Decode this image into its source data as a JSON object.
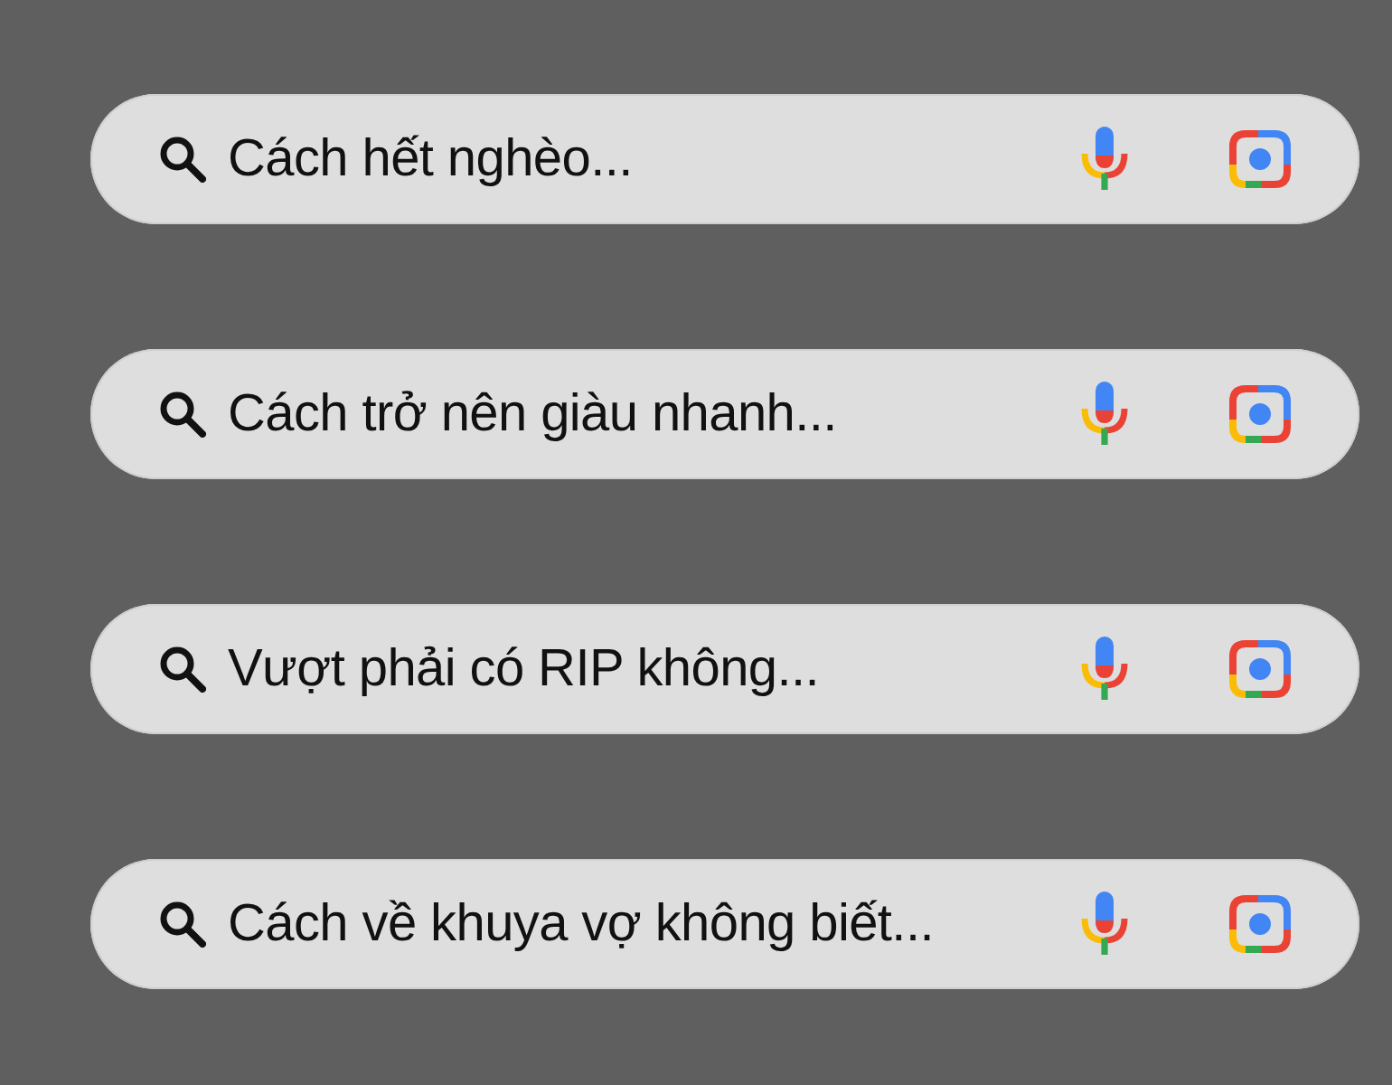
{
  "search_bars": [
    {
      "value": "Cách hết nghèo..."
    },
    {
      "value": "Cách trở nên giàu nhanh..."
    },
    {
      "value": "Vượt phải có RIP không..."
    },
    {
      "value": "Cách về khuya vợ không biết..."
    }
  ]
}
